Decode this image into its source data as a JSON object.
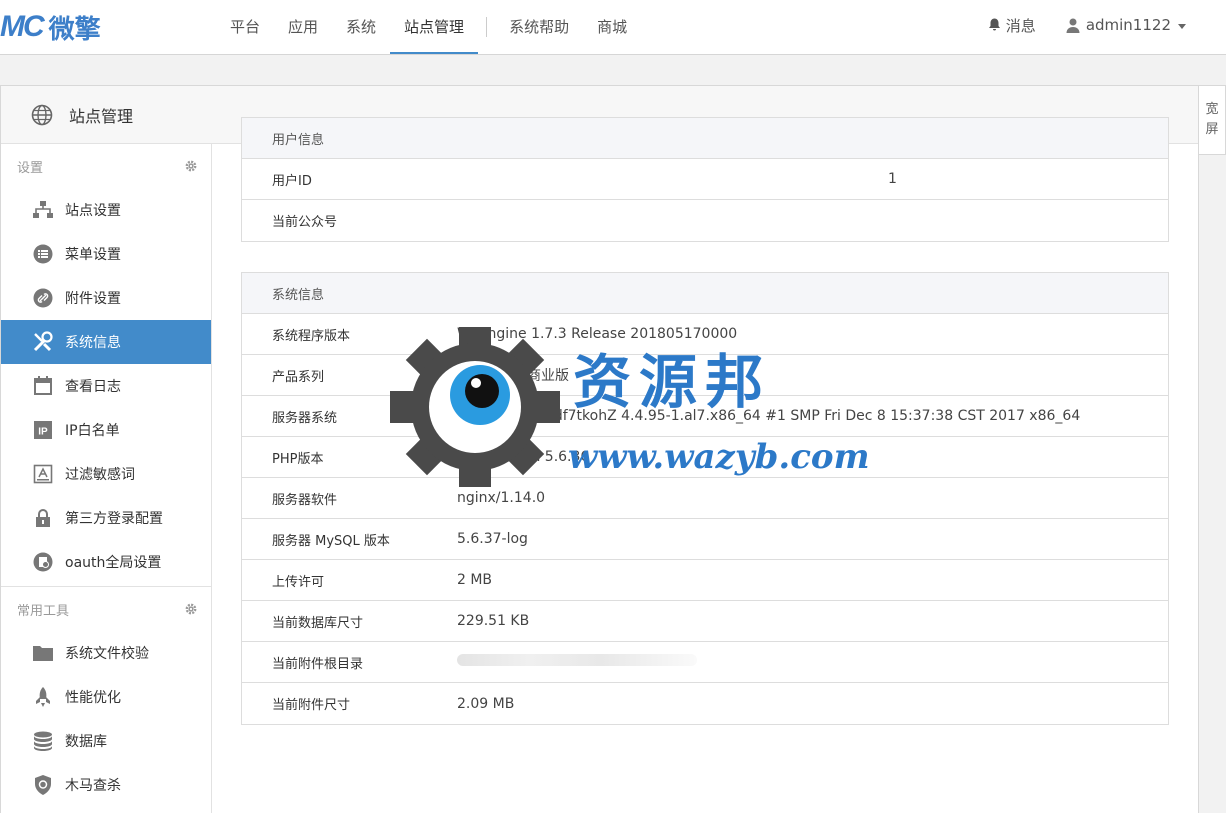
{
  "header": {
    "logo_mark": "MC",
    "logo_text": "微擎",
    "nav": [
      "平台",
      "应用",
      "系统",
      "站点管理",
      "系统帮助",
      "商城"
    ],
    "active_nav": "站点管理",
    "message_label": "消息",
    "user_label": "admin1122"
  },
  "panel": {
    "title": "站点管理",
    "wide_label_1": "宽",
    "wide_label_2": "屏"
  },
  "sidebar": {
    "group1_title": "设置",
    "group1_items": [
      {
        "label": "站点设置",
        "icon": "sitemap-icon"
      },
      {
        "label": "菜单设置",
        "icon": "menu-icon"
      },
      {
        "label": "附件设置",
        "icon": "attachment-icon"
      },
      {
        "label": "系统信息",
        "icon": "wrench-icon",
        "active": true
      },
      {
        "label": "查看日志",
        "icon": "calendar-icon"
      },
      {
        "label": "IP白名单",
        "icon": "ip-icon"
      },
      {
        "label": "过滤敏感词",
        "icon": "filter-word-icon"
      },
      {
        "label": "第三方登录配置",
        "icon": "lock-icon"
      },
      {
        "label": "oauth全局设置",
        "icon": "oauth-icon"
      }
    ],
    "group2_title": "常用工具",
    "group2_items": [
      {
        "label": "系统文件校验",
        "icon": "folder-icon"
      },
      {
        "label": "性能优化",
        "icon": "rocket-icon"
      },
      {
        "label": "数据库",
        "icon": "database-icon"
      },
      {
        "label": "木马查杀",
        "icon": "shield-icon"
      }
    ]
  },
  "user_info": {
    "title": "用户信息",
    "rows": [
      {
        "key": "用户ID",
        "value": "1"
      },
      {
        "key": "当前公众号",
        "value": ""
      }
    ]
  },
  "system_info": {
    "title": "系统信息",
    "rows": [
      {
        "key": "系统程序版本",
        "value": "WeEngine 1.7.3 Release 201805170000"
      },
      {
        "key": "产品系列",
        "value": "您的产品是商业版"
      },
      {
        "key": "服务器系统",
        "value": "Linux iZtwi7wdf7tkohZ 4.4.95-1.al7.x86_64 #1 SMP Fri Dec 8 15:37:38 CST 2017 x86_64"
      },
      {
        "key": "PHP版本",
        "value": "PHP Version 5.6.36"
      },
      {
        "key": "服务器软件",
        "value": "nginx/1.14.0"
      },
      {
        "key": "服务器 MySQL 版本",
        "value": "5.6.37-log"
      },
      {
        "key": "上传许可",
        "value": "2 MB"
      },
      {
        "key": "当前数据库尺寸",
        "value": "229.51 KB"
      },
      {
        "key": "当前附件根目录",
        "value": ""
      },
      {
        "key": "当前附件尺寸",
        "value": "2.09 MB"
      }
    ]
  },
  "watermark": {
    "title": "资源邦",
    "url": "www.wazyb.com"
  },
  "colors": {
    "accent": "#428bca",
    "watermark": "#2c79c8"
  }
}
